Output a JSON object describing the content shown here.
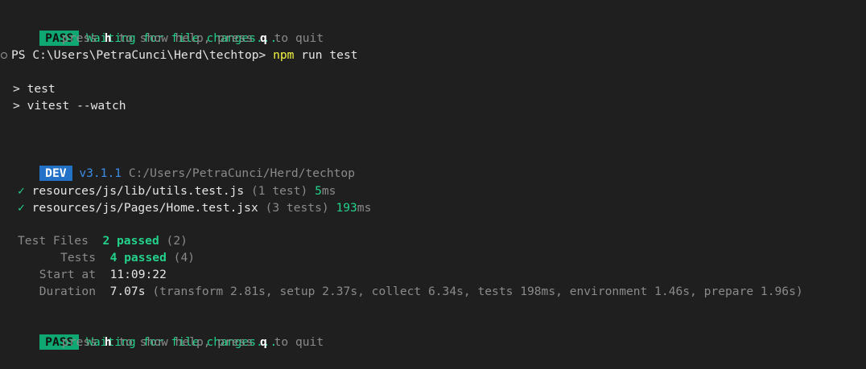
{
  "terminal": {
    "pass_top": {
      "badge": "PASS",
      "message": "Waiting for file changes...",
      "help_press": "press ",
      "help_h": "h",
      "help_mid": " to show help, press ",
      "help_q": "q",
      "help_end": " to quit"
    },
    "prompt": {
      "path": "PS C:\\Users\\PetraCunci\\Herd\\techtop> ",
      "cmd_npm": "npm",
      "cmd_rest": " run test"
    },
    "script_lines": [
      "> test",
      "> vitest --watch"
    ],
    "dev": {
      "badge": "DEV",
      "version": "v3.1.1",
      "path": "C:/Users/PetraCunci/Herd/techtop"
    },
    "results": [
      {
        "check": "✓",
        "file": "resources/js/lib/utils.test.js",
        "count": "(1 test)",
        "time_num": "5",
        "time_unit": "ms"
      },
      {
        "check": "✓",
        "file": "resources/js/Pages/Home.test.jsx",
        "count": "(3 tests)",
        "time_num": "193",
        "time_unit": "ms"
      }
    ],
    "summary": {
      "test_files_label": "Test Files",
      "test_files_passed": "2 passed",
      "test_files_total": "(2)",
      "tests_label": "Tests",
      "tests_passed": "4 passed",
      "tests_total": "(4)",
      "start_label": "Start at",
      "start_value": "11:09:22",
      "duration_label": "Duration",
      "duration_value": "7.07s",
      "duration_detail": "(transform 2.81s, setup 2.37s, collect 6.34s, tests 198ms, environment 1.46s, prepare 1.96s)"
    },
    "pass_bottom": {
      "badge": "PASS",
      "message": "Waiting for file changes...",
      "help_press": "press ",
      "help_h": "h",
      "help_mid": " to show help, press ",
      "help_q": "q",
      "help_end": " to quit"
    },
    "colors": {
      "background": "#1f1f1f",
      "pass_green": "#0fa872",
      "dev_blue": "#2472c8",
      "success_text": "#23d18b",
      "command_yellow": "#f5f543"
    }
  }
}
